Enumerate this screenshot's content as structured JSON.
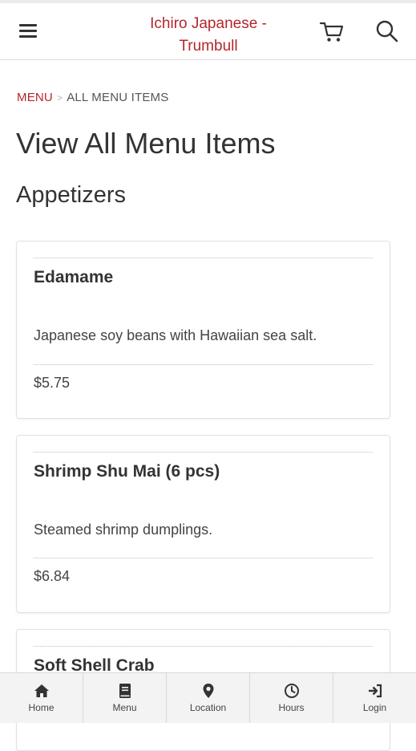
{
  "header": {
    "menu_icon": "hamburger-icon",
    "title_line1": "Ichiro Japanese -",
    "title_line2": "Trumbull",
    "title_color": "#b5262b",
    "cart_icon": "cart-icon",
    "search_icon": "search-icon"
  },
  "breadcrumb": {
    "link": "MENU",
    "separator": ">",
    "current": "ALL MENU ITEMS"
  },
  "page": {
    "title": "View All Menu Items",
    "section": "Appetizers"
  },
  "items": [
    {
      "name": "Edamame",
      "description": "Japanese soy beans with Hawaiian sea salt.",
      "price": "$5.75"
    },
    {
      "name": "Shrimp Shu Mai (6 pcs)",
      "description": "Steamed shrimp dumplings.",
      "price": "$6.84"
    },
    {
      "name": "Soft Shell Crab",
      "description": "",
      "price": ""
    }
  ],
  "bottom_nav": [
    {
      "label": "Home",
      "icon": "home-icon"
    },
    {
      "label": "Menu",
      "icon": "book-icon"
    },
    {
      "label": "Location",
      "icon": "map-pin-icon"
    },
    {
      "label": "Hours",
      "icon": "clock-icon"
    },
    {
      "label": "Login",
      "icon": "sign-in-icon"
    }
  ]
}
